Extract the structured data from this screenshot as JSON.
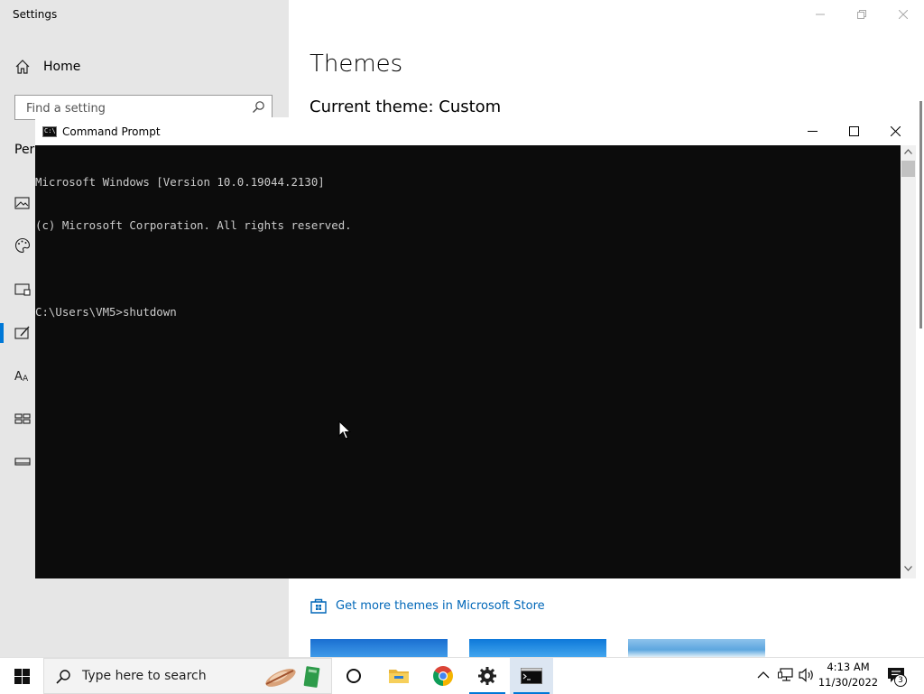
{
  "settings": {
    "window_title": "Settings",
    "home_label": "Home",
    "search_placeholder": "Find a setting",
    "section_label": "Pers",
    "page_title": "Themes",
    "current_theme": "Current theme: Custom",
    "store_link": "Get more themes in Microsoft Store",
    "nav_icons": [
      "background-icon",
      "colors-icon",
      "lock-screen-icon",
      "themes-icon",
      "fonts-icon",
      "start-icon",
      "taskbar-icon"
    ],
    "selected_nav": "themes-icon"
  },
  "cmd": {
    "title": "Command Prompt",
    "lines": [
      "Microsoft Windows [Version 10.0.19044.2130]",
      "(c) Microsoft Corporation. All rights reserved.",
      "",
      "C:\\Users\\VM5>shutdown"
    ]
  },
  "taskbar": {
    "search_placeholder": "Type here to search",
    "apps": [
      "cortana-icon",
      "file-explorer-icon",
      "chrome-icon",
      "settings-icon",
      "command-prompt-icon"
    ],
    "time": "4:13 AM",
    "date": "11/30/2022",
    "notification_count": "3"
  },
  "colors": {
    "accent": "#0078d7",
    "console_bg": "#0c0c0c",
    "console_text": "#cccccc",
    "link": "#0067b8"
  }
}
